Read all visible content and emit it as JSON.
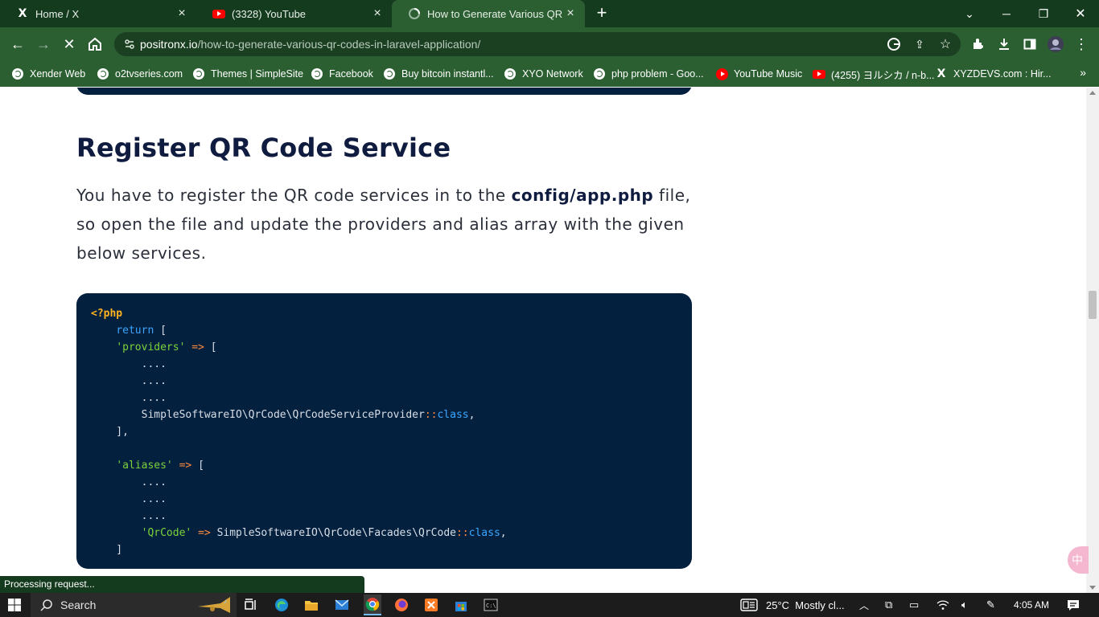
{
  "browser": {
    "tabs": [
      {
        "title": "Home / X",
        "icon": "x-logo-icon",
        "active": false
      },
      {
        "title": "(3328) YouTube",
        "icon": "youtube-icon",
        "active": false
      },
      {
        "title": "How to Generate Various QR Codes in Laravel",
        "icon": "loading-icon",
        "active": true
      }
    ],
    "url_host": "positronx.io",
    "url_path": "/how-to-generate-various-qr-codes-in-laravel-application/",
    "bookmarks": [
      {
        "label": "Xender Web",
        "icon": "globe-icon"
      },
      {
        "label": "o2tvseries.com",
        "icon": "globe-icon"
      },
      {
        "label": "Themes | SimpleSite",
        "icon": "globe-icon"
      },
      {
        "label": "Facebook",
        "icon": "globe-icon"
      },
      {
        "label": "Buy bitcoin instantl...",
        "icon": "globe-icon"
      },
      {
        "label": "XYO Network",
        "icon": "globe-icon"
      },
      {
        "label": "php problem - Goo...",
        "icon": "globe-icon"
      },
      {
        "label": "YouTube Music",
        "icon": "youtube-music-icon"
      },
      {
        "label": "(4255) ヨルシカ / n-b...",
        "icon": "youtube-icon"
      },
      {
        "label": "XYZDEVS.com : Hir...",
        "icon": "x-logo-icon"
      }
    ],
    "status_text": "Processing request..."
  },
  "article": {
    "heading": "Register QR Code Service",
    "para_before": "You have to register the QR code services in to the ",
    "para_bold": "config/app.php",
    "para_after": " file, so open the file and update the providers and alias array with the given below services."
  },
  "code": {
    "lines": [
      [
        {
          "t": "<?php",
          "c": "tag"
        }
      ],
      [
        {
          "t": "    ",
          "c": "plain"
        },
        {
          "t": "return",
          "c": "kw"
        },
        {
          "t": " [",
          "c": "plain"
        }
      ],
      [
        {
          "t": "    ",
          "c": "plain"
        },
        {
          "t": "'providers'",
          "c": "str"
        },
        {
          "t": " => ",
          "c": "op"
        },
        {
          "t": "[",
          "c": "plain"
        }
      ],
      [
        {
          "t": "        ....",
          "c": "plain"
        }
      ],
      [
        {
          "t": "        ....",
          "c": "plain"
        }
      ],
      [
        {
          "t": "        ....",
          "c": "plain"
        }
      ],
      [
        {
          "t": "        SimpleSoftwareIO\\QrCode\\QrCodeServiceProvider",
          "c": "plain"
        },
        {
          "t": "::",
          "c": "op"
        },
        {
          "t": "class",
          "c": "cls"
        },
        {
          "t": ",",
          "c": "plain"
        }
      ],
      [
        {
          "t": "    ],",
          "c": "plain"
        }
      ],
      [
        {
          "t": "",
          "c": "plain"
        }
      ],
      [
        {
          "t": "    ",
          "c": "plain"
        },
        {
          "t": "'aliases'",
          "c": "str"
        },
        {
          "t": " => ",
          "c": "op"
        },
        {
          "t": "[",
          "c": "plain"
        }
      ],
      [
        {
          "t": "        ....",
          "c": "plain"
        }
      ],
      [
        {
          "t": "        ....",
          "c": "plain"
        }
      ],
      [
        {
          "t": "        ....",
          "c": "plain"
        }
      ],
      [
        {
          "t": "        ",
          "c": "plain"
        },
        {
          "t": "'QrCode'",
          "c": "str"
        },
        {
          "t": " => ",
          "c": "op"
        },
        {
          "t": "SimpleSoftwareIO\\QrCode\\Facades\\QrCode",
          "c": "plain"
        },
        {
          "t": "::",
          "c": "op"
        },
        {
          "t": "class",
          "c": "cls"
        },
        {
          "t": ",",
          "c": "plain"
        }
      ],
      [
        {
          "t": "    ]",
          "c": "plain"
        }
      ]
    ]
  },
  "taskbar": {
    "search_placeholder": "Search",
    "weather": "25°C  Mostly cl...",
    "time": "4:05 AM"
  },
  "floating_badge": "中",
  "colors": {
    "tabstrip": "#153b1f",
    "toolbar": "#2b5f31",
    "code_bg": "#03213f",
    "heading": "#0f1c3f"
  }
}
